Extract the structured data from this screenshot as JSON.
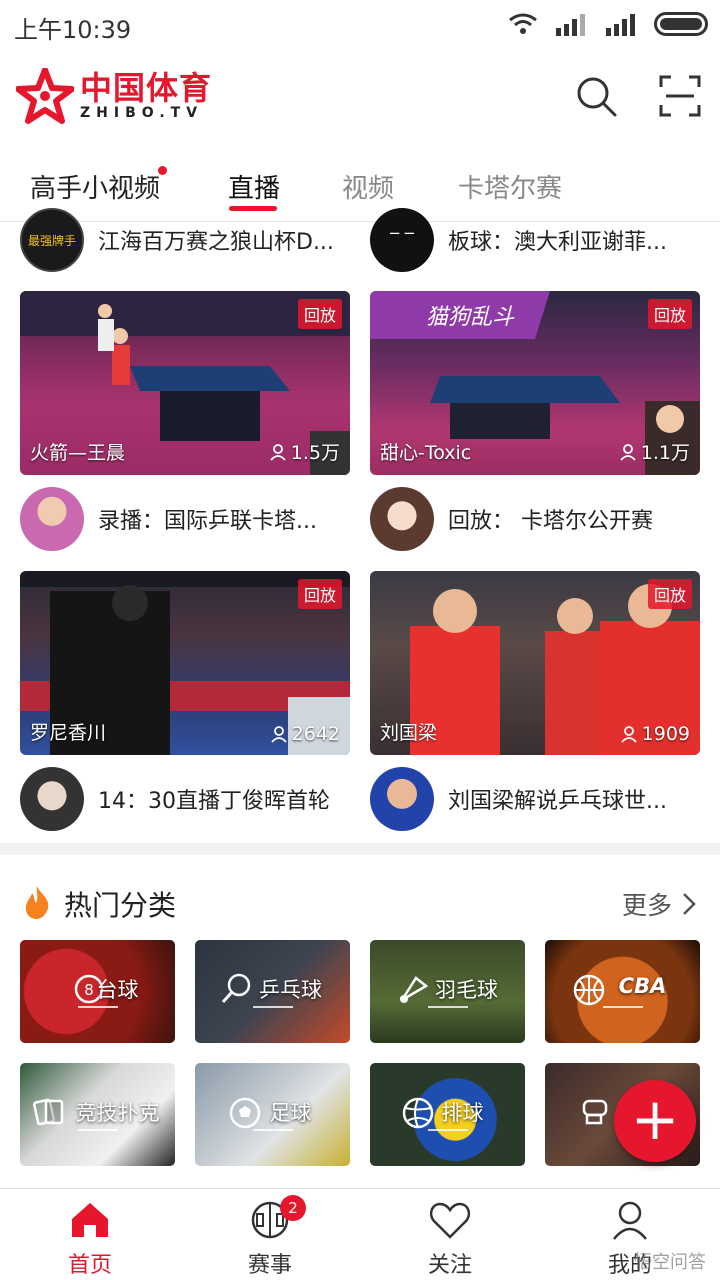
{
  "status_bar": {
    "time": "上午10:39"
  },
  "header": {
    "logo_cn": "中国体育",
    "logo_en": "ZHIBO.TV",
    "icons": [
      "search-icon",
      "scan-icon"
    ]
  },
  "tabs": [
    {
      "label": "高手小视频",
      "has_dot": true
    },
    {
      "label": "直播",
      "active": true
    },
    {
      "label": "视频"
    },
    {
      "label": "卡塔尔赛"
    }
  ],
  "top_rows": [
    {
      "title": "江海百万赛之狼山杯D..."
    },
    {
      "title": "板球：澳大利亚谢菲..."
    }
  ],
  "cards_row1": [
    {
      "badge": "回放",
      "name": "火箭—王晨",
      "viewers": "1.5万"
    },
    {
      "badge": "回放",
      "name": "甜心-Toxic",
      "viewers": "1.1万",
      "overlay_text": "猫狗乱斗"
    }
  ],
  "titles_row1": [
    {
      "title": "录播：国际乒联卡塔..."
    },
    {
      "title": "回放： 卡塔尔公开赛"
    }
  ],
  "cards_row2": [
    {
      "badge": "回放",
      "name": "罗尼香川",
      "viewers": "2642"
    },
    {
      "badge": "回放",
      "name": "刘国梁",
      "viewers": "1909"
    }
  ],
  "titles_row2": [
    {
      "title": "14：30直播丁俊晖首轮"
    },
    {
      "title": "刘国梁解说乒乓球世..."
    }
  ],
  "hot": {
    "title": "热门分类",
    "more": "更多",
    "categories": [
      {
        "label": "台球"
      },
      {
        "label": "乒乓球"
      },
      {
        "label": "羽毛球"
      },
      {
        "label": "CBA"
      },
      {
        "label": "竞技扑克"
      },
      {
        "label": "足球"
      },
      {
        "label": "排球"
      },
      {
        "label": ""
      }
    ]
  },
  "fab": {
    "label": "+"
  },
  "bottom_nav": [
    {
      "label": "首页",
      "active": true
    },
    {
      "label": "赛事",
      "badge": "2"
    },
    {
      "label": "关注"
    },
    {
      "label": "我的"
    }
  ],
  "watermark": "悟空问答",
  "colors": {
    "accent": "#e6162d"
  }
}
